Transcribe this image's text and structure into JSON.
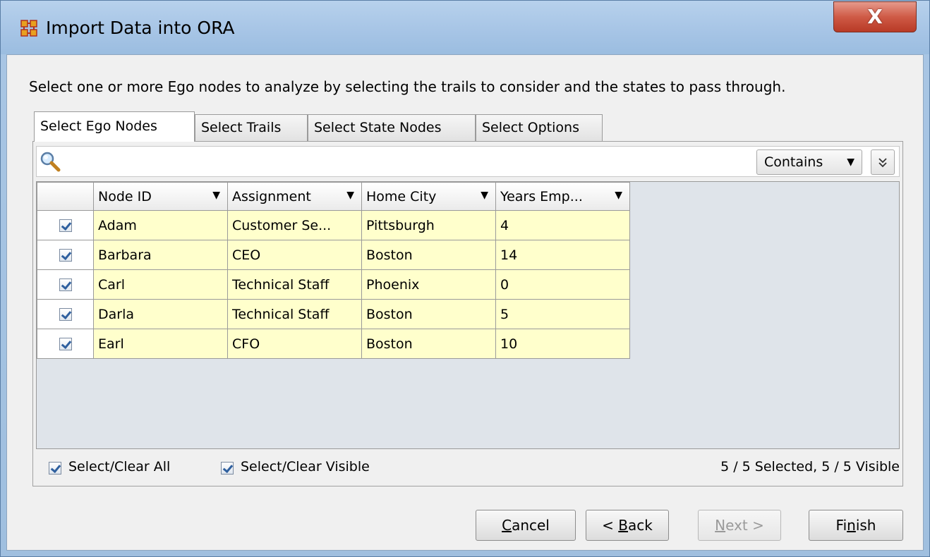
{
  "window": {
    "title": "Import Data into ORA",
    "close_label": "X",
    "icon": "ora-grid-icon"
  },
  "instruction": "Select one or more Ego nodes to analyze by selecting the trails to consider and the states to pass through.",
  "tabs": [
    {
      "label": "Select Ego Nodes",
      "active": true
    },
    {
      "label": "Select Trails",
      "active": false
    },
    {
      "label": "Select State Nodes",
      "active": false
    },
    {
      "label": "Select Options",
      "active": false
    }
  ],
  "search": {
    "icon": "search-icon",
    "value": "",
    "mode_label": "Contains",
    "expand_icon": "chevron-double-down-icon"
  },
  "table": {
    "columns": [
      "Node ID",
      "Assignment",
      "Home City",
      "Years Emp..."
    ],
    "rows": [
      {
        "checked": true,
        "cells": [
          "Adam",
          "Customer Se...",
          "Pittsburgh",
          "4"
        ]
      },
      {
        "checked": true,
        "cells": [
          "Barbara",
          "CEO",
          "Boston",
          "14"
        ]
      },
      {
        "checked": true,
        "cells": [
          "Carl",
          "Technical Staff",
          "Phoenix",
          "0"
        ]
      },
      {
        "checked": true,
        "cells": [
          "Darla",
          "Technical Staff",
          "Boston",
          "5"
        ]
      },
      {
        "checked": true,
        "cells": [
          "Earl",
          "CFO",
          "Boston",
          "10"
        ]
      }
    ]
  },
  "footer": {
    "select_all_label": "Select/Clear All",
    "select_visible_label": "Select/Clear Visible",
    "status": "5 / 5 Selected, 5 / 5 Visible"
  },
  "buttons": {
    "cancel": {
      "prefix": "",
      "mnemonic": "C",
      "rest": "ancel"
    },
    "back": {
      "prefix": "< ",
      "mnemonic": "B",
      "rest": "ack"
    },
    "next": {
      "prefix": "",
      "mnemonic": "N",
      "rest": "ext >",
      "disabled": true
    },
    "finish": {
      "prefix": "Fi",
      "mnemonic": "n",
      "rest": "ish"
    }
  },
  "colors": {
    "row_fill": "#ffffcc",
    "title_bar": "#a7c5e6",
    "close_button": "#c94a36"
  }
}
